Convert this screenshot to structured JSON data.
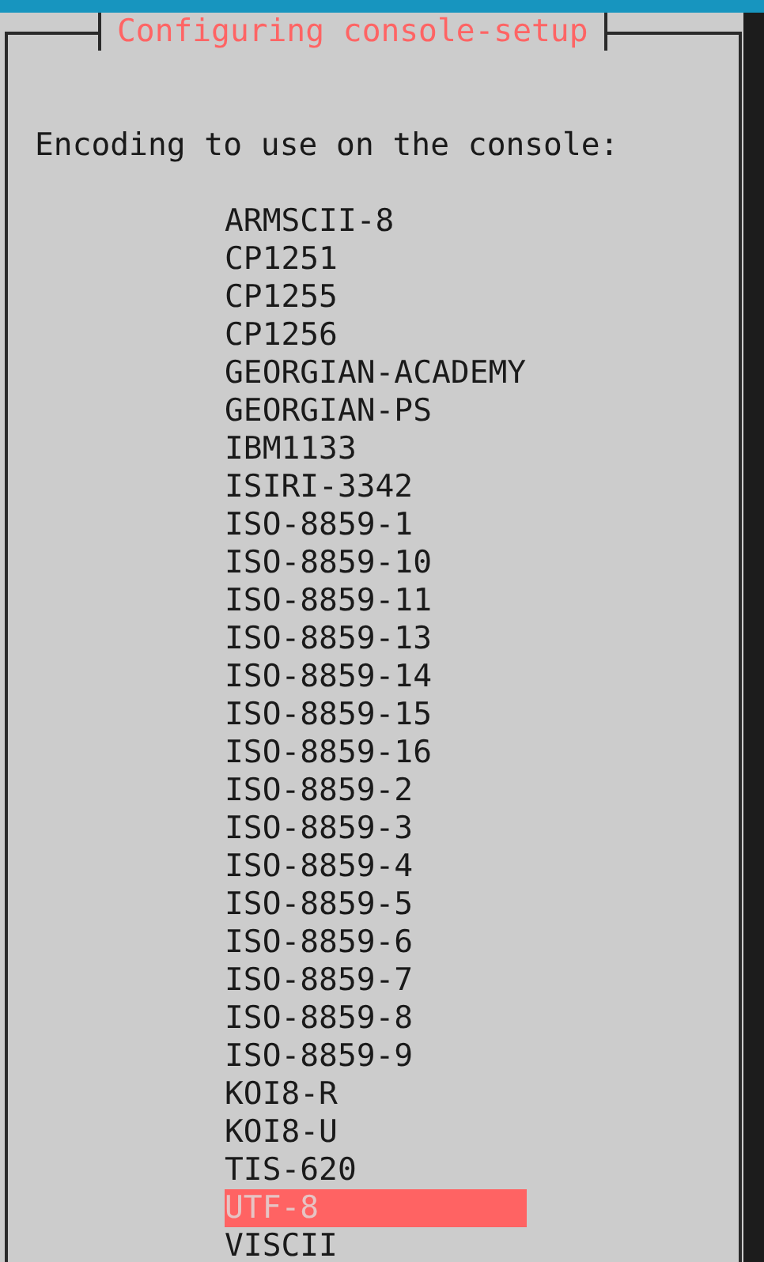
{
  "dialog": {
    "title": "Configuring console-setup",
    "prompt": "Encoding to use on the console:",
    "options": [
      {
        "label": "ARMSCII-8",
        "selected": false
      },
      {
        "label": "CP1251",
        "selected": false
      },
      {
        "label": "CP1255",
        "selected": false
      },
      {
        "label": "CP1256",
        "selected": false
      },
      {
        "label": "GEORGIAN-ACADEMY",
        "selected": false
      },
      {
        "label": "GEORGIAN-PS",
        "selected": false
      },
      {
        "label": "IBM1133",
        "selected": false
      },
      {
        "label": "ISIRI-3342",
        "selected": false
      },
      {
        "label": "ISO-8859-1",
        "selected": false
      },
      {
        "label": "ISO-8859-10",
        "selected": false
      },
      {
        "label": "ISO-8859-11",
        "selected": false
      },
      {
        "label": "ISO-8859-13",
        "selected": false
      },
      {
        "label": "ISO-8859-14",
        "selected": false
      },
      {
        "label": "ISO-8859-15",
        "selected": false
      },
      {
        "label": "ISO-8859-16",
        "selected": false
      },
      {
        "label": "ISO-8859-2",
        "selected": false
      },
      {
        "label": "ISO-8859-3",
        "selected": false
      },
      {
        "label": "ISO-8859-4",
        "selected": false
      },
      {
        "label": "ISO-8859-5",
        "selected": false
      },
      {
        "label": "ISO-8859-6",
        "selected": false
      },
      {
        "label": "ISO-8859-7",
        "selected": false
      },
      {
        "label": "ISO-8859-8",
        "selected": false
      },
      {
        "label": "ISO-8859-9",
        "selected": false
      },
      {
        "label": "KOI8-R",
        "selected": false
      },
      {
        "label": "KOI8-U",
        "selected": false
      },
      {
        "label": "TIS-620",
        "selected": false
      },
      {
        "label": "UTF-8",
        "selected": true
      },
      {
        "label": "VISCII",
        "selected": false
      }
    ]
  }
}
